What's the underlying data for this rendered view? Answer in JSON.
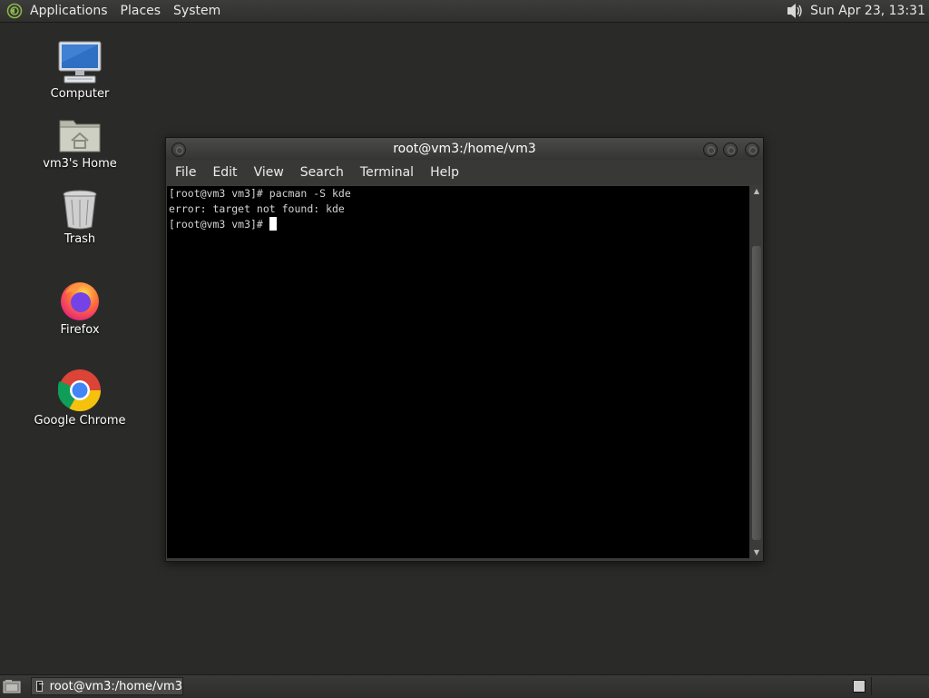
{
  "top_panel": {
    "menus": [
      "Applications",
      "Places",
      "System"
    ],
    "clock": "Sun Apr 23, 13:31"
  },
  "desktop": {
    "icons": [
      {
        "label": "Computer",
        "icon": "computer-icon"
      },
      {
        "label": "vm3's Home",
        "icon": "home-folder-icon"
      },
      {
        "label": "Trash",
        "icon": "trash-icon"
      },
      {
        "label": "Firefox",
        "icon": "firefox-icon"
      },
      {
        "label": "Google Chrome",
        "icon": "chrome-icon"
      }
    ]
  },
  "terminal": {
    "title": "root@vm3:/home/vm3",
    "menu": [
      "File",
      "Edit",
      "View",
      "Search",
      "Terminal",
      "Help"
    ],
    "lines": [
      "[root@vm3 vm3]# pacman -S kde",
      "error: target not found: kde",
      "[root@vm3 vm3]# "
    ]
  },
  "taskbar": {
    "task_label": "root@vm3:/home/vm3"
  }
}
